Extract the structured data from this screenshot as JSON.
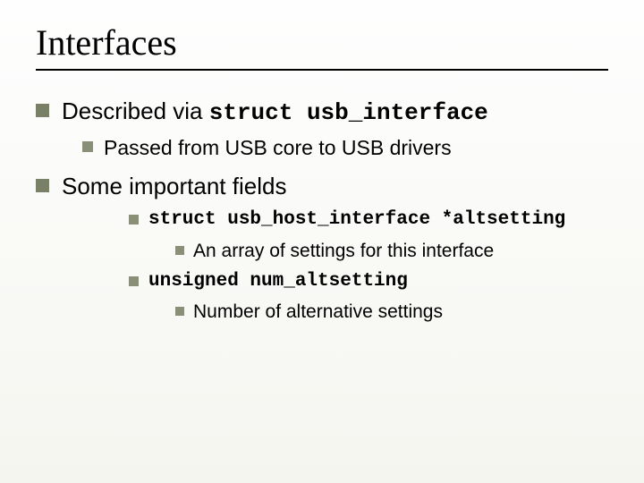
{
  "title": "Interfaces",
  "b1": {
    "pre": "Described via ",
    "code": "struct usb_interface",
    "sub1": "Passed from USB core to USB drivers"
  },
  "b2": {
    "text": "Some important fields",
    "f1": {
      "code": "struct usb_host_interface *altsetting",
      "desc": "An array of settings for this interface"
    },
    "f2": {
      "code": "unsigned num_altsetting",
      "desc": "Number of alternative settings"
    }
  }
}
